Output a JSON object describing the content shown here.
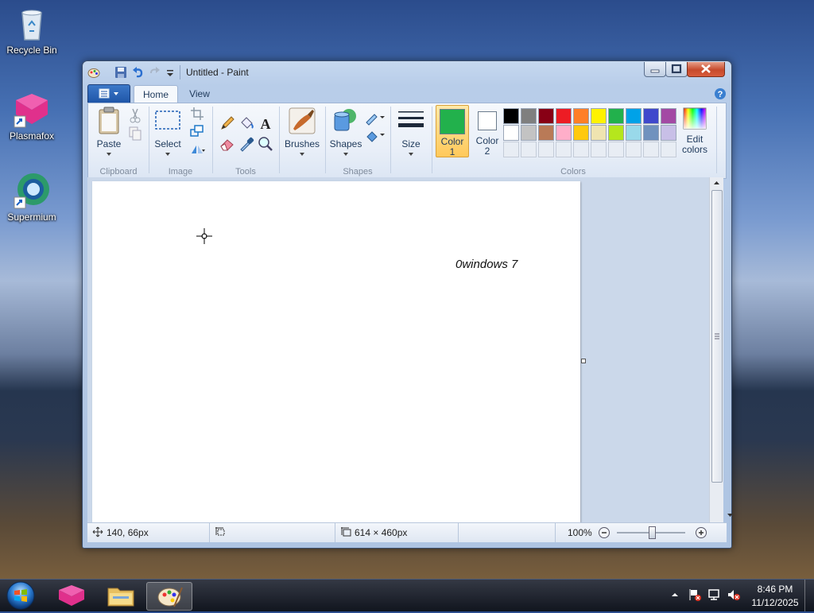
{
  "desktop": {
    "icons": [
      {
        "label": "Recycle Bin"
      },
      {
        "label": "Plasmafox"
      },
      {
        "label": "Supermium"
      }
    ]
  },
  "window": {
    "title": "Untitled - Paint",
    "tabs": [
      "Home",
      "View"
    ],
    "ribbon": {
      "clipboard": {
        "paste": "Paste",
        "group": "Clipboard"
      },
      "image": {
        "select": "Select",
        "group": "Image"
      },
      "tools": {
        "group": "Tools",
        "text_tool": "A"
      },
      "brushes": {
        "label": "Brushes"
      },
      "shapes": {
        "label": "Shapes",
        "group": "Shapes"
      },
      "size": {
        "label": "Size"
      },
      "colors": {
        "color1_line1": "Color",
        "color1_line2": "1",
        "color2_line1": "Color",
        "color2_line2": "2",
        "edit_line1": "Edit",
        "edit_line2": "colors",
        "group": "Colors",
        "color1": "#22b14c",
        "color2": "#ffffff",
        "palette_row1": [
          "#000000",
          "#7f7f7f",
          "#880015",
          "#ed1c24",
          "#ff7f27",
          "#fff200",
          "#22b14c",
          "#00a2e8",
          "#3f48cc",
          "#a349a4"
        ],
        "palette_row2": [
          "#ffffff",
          "#c3c3c3",
          "#b97a57",
          "#ffaec9",
          "#ffc90e",
          "#efe4b0",
          "#b5e61d",
          "#99d9ea",
          "#7092be",
          "#c8bfe7"
        ]
      }
    },
    "canvas_text": "0windows 7",
    "status": {
      "cursor_pos": "140, 66px",
      "selection_size": "",
      "image_size": "614 × 460px",
      "zoom": "100%"
    }
  },
  "taskbar": {
    "time": "8:46 PM",
    "date": "11/12/2025"
  }
}
